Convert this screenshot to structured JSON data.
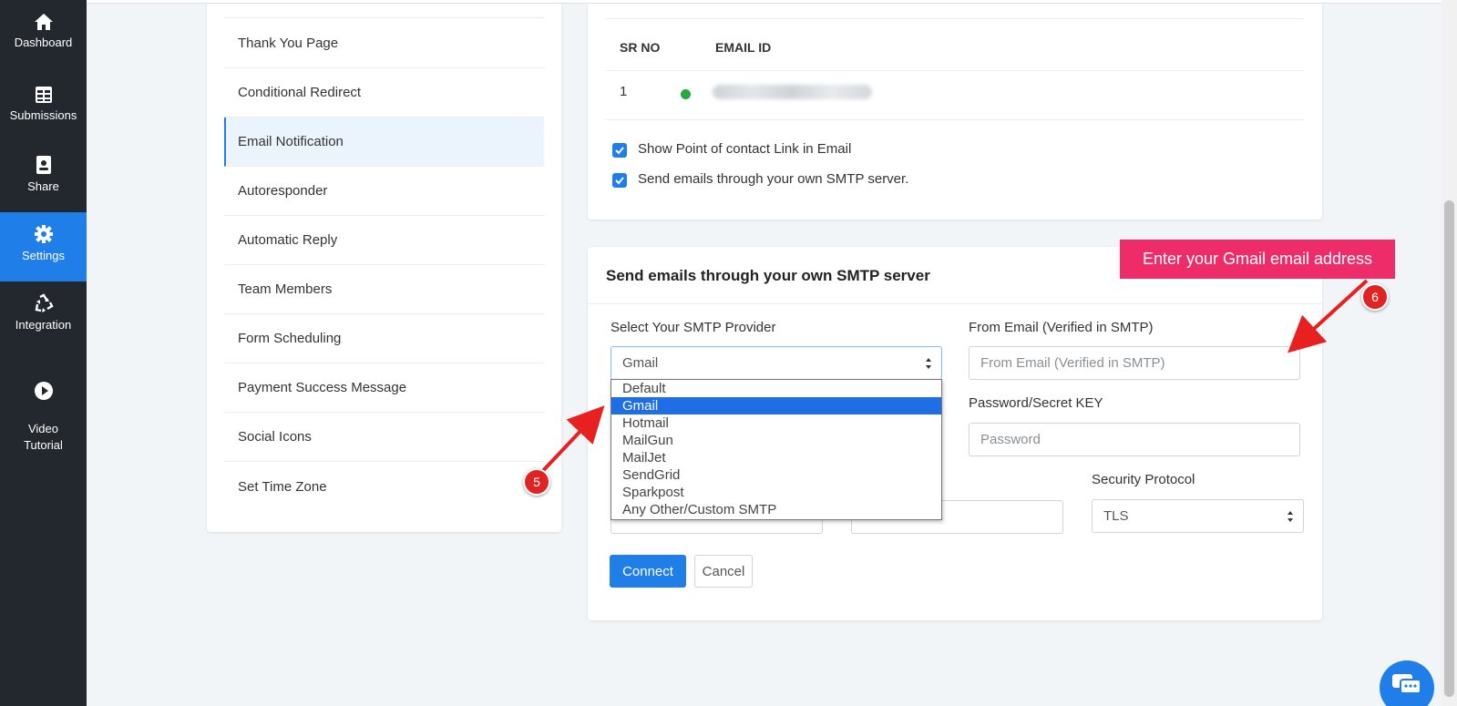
{
  "rail": {
    "items": [
      {
        "label": "Dashboard",
        "icon": "home-icon"
      },
      {
        "label": "Submissions",
        "icon": "table-icon"
      },
      {
        "label": "Share",
        "icon": "share-icon"
      },
      {
        "label": "Settings",
        "icon": "gear-icon",
        "active": true
      },
      {
        "label": "Integration",
        "icon": "recycle-icon"
      },
      {
        "label": "Video\nTutorial",
        "icon": "play-circle-icon"
      }
    ]
  },
  "settings_nav": {
    "items": [
      {
        "label": "Thank You Page"
      },
      {
        "label": "Conditional Redirect"
      },
      {
        "label": "Email Notification",
        "active": true
      },
      {
        "label": "Autoresponder"
      },
      {
        "label": "Automatic Reply"
      },
      {
        "label": "Team Members"
      },
      {
        "label": "Form Scheduling"
      },
      {
        "label": "Payment Success Message"
      },
      {
        "label": "Social Icons"
      },
      {
        "label": "Set Time Zone"
      }
    ]
  },
  "email_list": {
    "col_sr": "SR NO",
    "col_email": "EMAIL ID",
    "rows": [
      {
        "sr": "1",
        "status_color": "#27a844"
      }
    ],
    "checkbox_poc": "Show Point of contact Link in Email",
    "checkbox_smtp": "Send emails through your own SMTP server."
  },
  "smtp": {
    "title": "Send emails through your own SMTP server",
    "provider_label": "Select Your SMTP Provider",
    "provider_value": "Gmail",
    "from_email_label": "From Email (Verified in SMTP)",
    "from_email_placeholder": "From Email (Verified in SMTP)",
    "password_label": "Password/Secret KEY",
    "password_placeholder": "Password",
    "security_label": "Security Protocol",
    "security_value": "TLS",
    "connect_label": "Connect",
    "cancel_label": "Cancel",
    "options": [
      "Default",
      "Gmail",
      "Hotmail",
      "MailGun",
      "MailJet",
      "SendGrid",
      "Sparkpost",
      "Any Other/Custom SMTP"
    ],
    "selected_option": "Gmail"
  },
  "annotations": {
    "callout": "Enter your Gmail email address",
    "badge_5": "5",
    "badge_6": "6"
  },
  "colors": {
    "accent": "#1f7ee8",
    "rail_bg": "#23282e",
    "callout_bg": "#ef2c6a",
    "badge_bg": "#e02424"
  }
}
